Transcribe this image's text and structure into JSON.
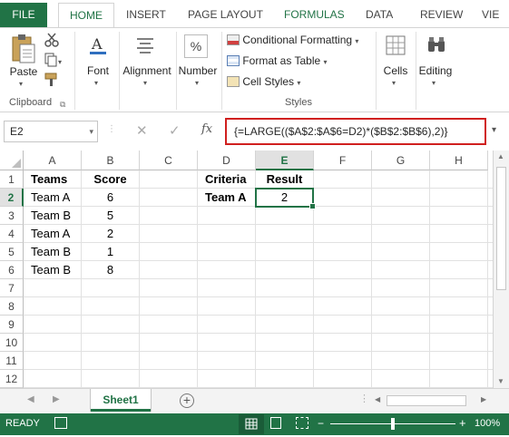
{
  "ribbon_tabs": {
    "file": "FILE",
    "home": "HOME",
    "insert": "INSERT",
    "page_layout": "PAGE LAYOUT",
    "formulas": "FORMULAS",
    "data": "DATA",
    "review": "REVIEW",
    "view": "VIE"
  },
  "ribbon": {
    "paste": "Paste",
    "clipboard_label": "Clipboard",
    "font": "Font",
    "alignment": "Alignment",
    "number": "Number",
    "conditional_formatting": "Conditional Formatting",
    "format_as_table": "Format as Table",
    "cell_styles": "Cell Styles",
    "styles_label": "Styles",
    "cells": "Cells",
    "editing": "Editing"
  },
  "formula_bar": {
    "name_box": "E2",
    "formula": "{=LARGE(($A$2:$A$6=D2)*($B$2:$B$6),2)}"
  },
  "grid": {
    "columns": [
      "A",
      "B",
      "C",
      "D",
      "E",
      "F",
      "G",
      "H"
    ],
    "rows": [
      "1",
      "2",
      "3",
      "4",
      "5",
      "6",
      "7",
      "8",
      "9",
      "10",
      "11",
      "12"
    ],
    "cells": {
      "A1": "Teams",
      "B1": "Score",
      "A2": "Team A",
      "B2": "6",
      "A3": "Team B",
      "B3": "5",
      "A4": "Team A",
      "B4": "2",
      "A5": "Team B",
      "B5": "1",
      "A6": "Team B",
      "B6": "8",
      "D1": "Criteria",
      "E1": "Result",
      "D2": "Team A",
      "E2": "2"
    }
  },
  "sheet_tabs": {
    "active": "Sheet1"
  },
  "status_bar": {
    "state": "READY",
    "zoom": "100%",
    "zoom_level_percent": 100
  },
  "colors": {
    "accent": "#217346",
    "highlight_border": "#d0201f"
  }
}
